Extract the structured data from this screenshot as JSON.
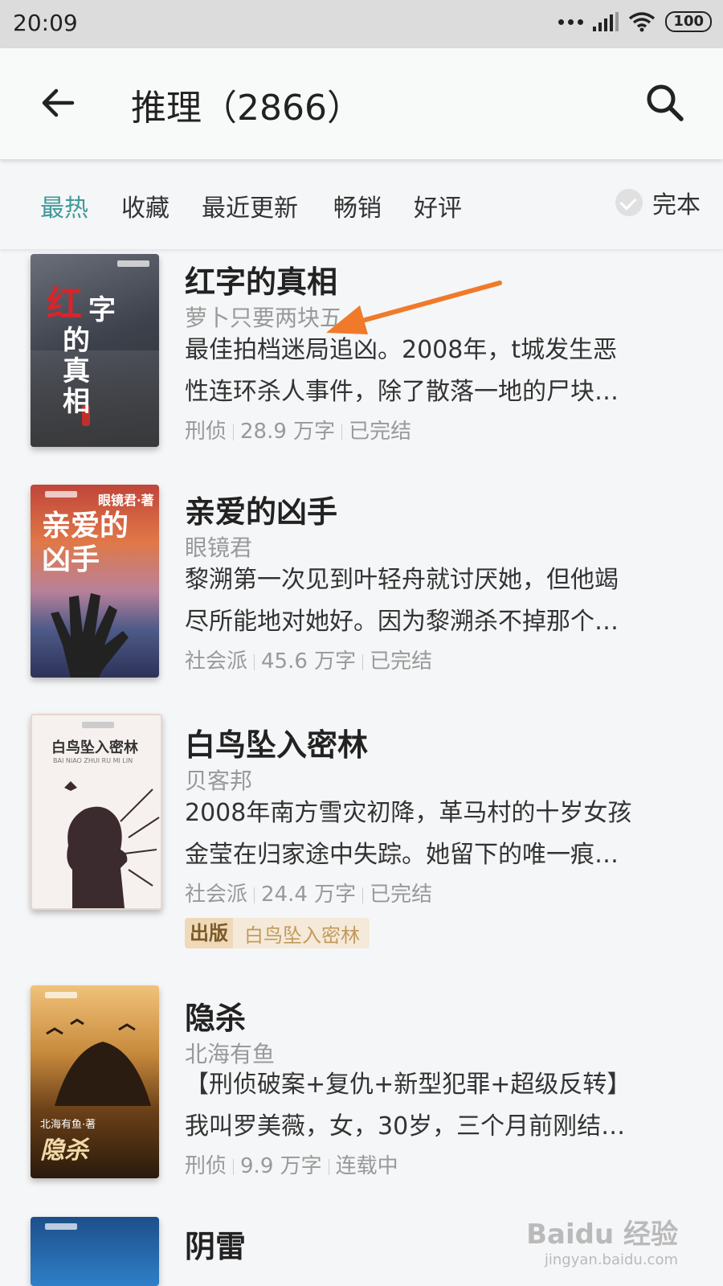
{
  "status_bar": {
    "time": "20:09",
    "battery": "100"
  },
  "header": {
    "title": "推理（2866）"
  },
  "filters": {
    "tabs": [
      "最热",
      "收藏",
      "最近更新",
      "畅销",
      "好评"
    ],
    "active_index": 0,
    "complete_label": "完本"
  },
  "books": [
    {
      "title": "红字的真相",
      "author": "萝卜只要两块五",
      "desc_line1": "最佳拍档迷局追凶。2008年，t城发生恶",
      "desc_line2": "性连环杀人事件，除了散落一地的尸块…",
      "category": "刑侦",
      "words": "28.9 万字",
      "status": "已完结",
      "cover_text": [
        "红",
        "字",
        "的",
        "真",
        "相"
      ]
    },
    {
      "title": "亲爱的凶手",
      "author": "眼镜君",
      "desc_line1": "黎溯第一次见到叶轻舟就讨厌她，但他竭",
      "desc_line2": "尽所能地对她好。因为黎溯杀不掉那个…",
      "category": "社会派",
      "words": "45.6 万字",
      "status": "已完结",
      "cover_title": "亲爱的凶手",
      "cover_author": "眼镜君·著"
    },
    {
      "title": "白鸟坠入密林",
      "author": "贝客邦",
      "desc_line1": "2008年南方雪灾初降，革马村的十岁女孩",
      "desc_line2": "金莹在归家途中失踪。她留下的唯一痕…",
      "category": "社会派",
      "words": "24.4 万字",
      "status": "已完结",
      "badge_tag": "出版",
      "badge_name": "白鸟坠入密林",
      "cover_title": "白鸟坠入密林",
      "cover_pinyin": "BAI NIAO ZHUI RU MI LIN"
    },
    {
      "title": "隐杀",
      "author": "北海有鱼",
      "desc_line1": "【刑侦破案+复仇+新型犯罪+超级反转】",
      "desc_line2": "我叫罗美薇，女，30岁，三个月前刚结…",
      "category": "刑侦",
      "words": "9.9 万字",
      "status": "连载中",
      "cover_title": "隐杀",
      "cover_author": "北海有鱼·著"
    },
    {
      "title": "阴雷"
    }
  ],
  "watermark": {
    "main": "Baidu 经验",
    "sub": "jingyan.baidu.com"
  },
  "colors": {
    "accent": "#3f9a9a",
    "arrow": "#f07a2a"
  }
}
